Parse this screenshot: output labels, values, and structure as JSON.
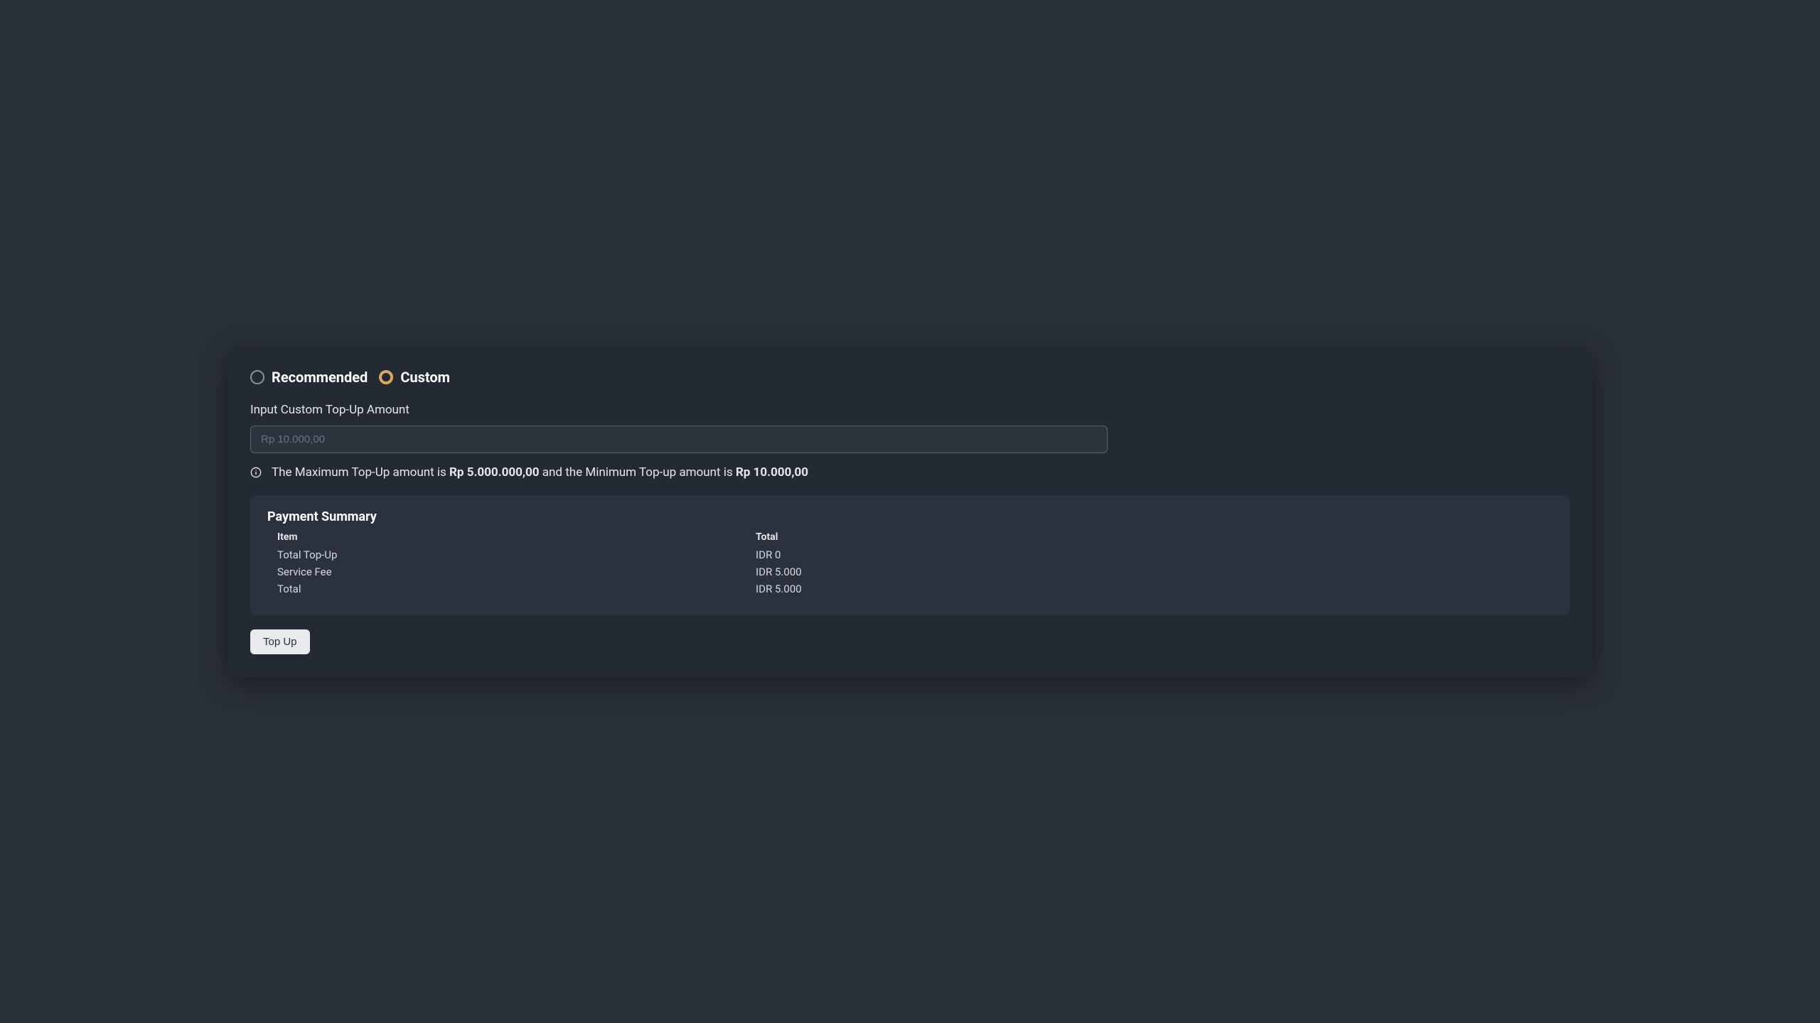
{
  "radio": {
    "recommended_label": "Recommended",
    "custom_label": "Custom"
  },
  "input": {
    "label": "Input Custom Top-Up Amount",
    "placeholder": "Rp 10.000,00",
    "value": ""
  },
  "helper": {
    "prefix": "The Maximum Top-Up amount is ",
    "max": "Rp 5.000.000,00",
    "middle": " and the Minimum Top-up amount is ",
    "min": "Rp 10.000,00"
  },
  "summary": {
    "title": "Payment Summary",
    "headers": {
      "item": "Item",
      "total": "Total"
    },
    "rows": [
      {
        "item": "Total Top-Up",
        "total": "IDR 0"
      },
      {
        "item": "Service Fee",
        "total": "IDR 5.000"
      },
      {
        "item": "Total",
        "total": "IDR 5.000"
      }
    ]
  },
  "button": {
    "topup": "Top Up"
  }
}
